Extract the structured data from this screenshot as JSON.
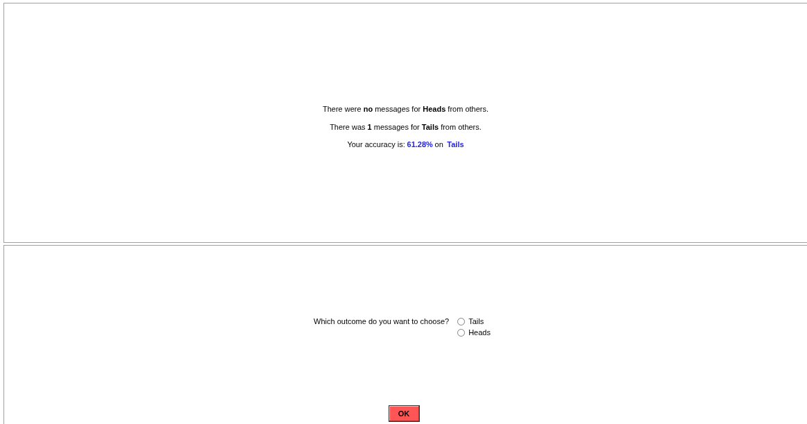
{
  "results": {
    "messages": [
      "There were **no** messages for **Heads** from others.",
      "There was **1** messages for **Tails** from others."
    ],
    "accuracy": {
      "label": "Your accuracy is:",
      "value": "61.28%",
      "connector": "on",
      "outcome": "Tails"
    }
  },
  "choice": {
    "question": "Which outcome do you want to choose?",
    "options": [
      {
        "label": "Tails",
        "selected": false
      },
      {
        "label": "Heads",
        "selected": false
      }
    ]
  },
  "ok_button": "OK"
}
